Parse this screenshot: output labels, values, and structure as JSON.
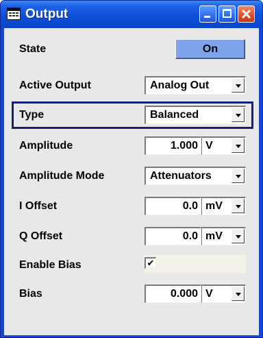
{
  "window": {
    "title": "Output"
  },
  "rows": {
    "state": {
      "label": "State",
      "button": "On"
    },
    "active_output": {
      "label": "Active Output",
      "value": "Analog Out"
    },
    "type": {
      "label": "Type",
      "value": "Balanced"
    },
    "amplitude": {
      "label": "Amplitude",
      "value": "1.000",
      "unit": "V"
    },
    "amplitude_mode": {
      "label": "Amplitude Mode",
      "value": "Attenuators"
    },
    "i_offset": {
      "label": "I Offset",
      "value": "0.0",
      "unit": "mV"
    },
    "q_offset": {
      "label": "Q Offset",
      "value": "0.0",
      "unit": "mV"
    },
    "enable_bias": {
      "label": "Enable Bias",
      "checked": true,
      "check_glyph": "✔"
    },
    "bias": {
      "label": "Bias",
      "value": "0.000",
      "unit": "V"
    }
  },
  "colors": {
    "titlebar": "#0f4fd8",
    "on_button": "#7ea3e8",
    "focus_frame": "#15207a",
    "panel": "#e8e8e8"
  }
}
